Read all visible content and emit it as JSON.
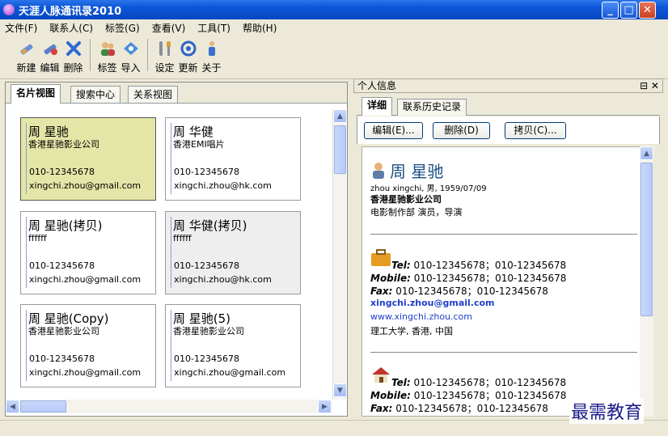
{
  "window": {
    "title": "天涯人脉通讯录2010"
  },
  "menu": [
    "文件(F)",
    "联系人(C)",
    "标签(G)",
    "查看(V)",
    "工具(T)",
    "帮助(H)"
  ],
  "toolbar": {
    "new": "新建",
    "edit": "编辑",
    "delete": "删除",
    "tag": "标签",
    "import": "导入",
    "settings": "设定",
    "refresh": "更新",
    "about": "关于"
  },
  "left_tabs": [
    "名片视图",
    "搜索中心",
    "关系视图"
  ],
  "cards": [
    {
      "name": "周 星驰",
      "company": "香港星驰影业公司",
      "phone": "010-12345678",
      "email": "xingchi.zhou@gmail.com"
    },
    {
      "name": "周 华健",
      "company": "香港EMI唱片",
      "phone": "010-12345678",
      "email": "xingchi.zhou@hk.com"
    },
    {
      "name": "周 星驰(拷贝)",
      "company": "ffffff",
      "phone": "010-12345678",
      "email": "xingchi.zhou@gmail.com"
    },
    {
      "name": "周 华健(拷贝)",
      "company": "ffffff",
      "phone": "010-12345678",
      "email": "xingchi.zhou@hk.com"
    },
    {
      "name": "周 星驰(Copy)",
      "company": "香港星驰影业公司",
      "phone": "010-12345678",
      "email": "xingchi.zhou@gmail.com"
    },
    {
      "name": "周 星驰(5)",
      "company": "香港星驰影业公司",
      "phone": "010-12345678",
      "email": "xingchi.zhou@gmail.com"
    }
  ],
  "right_panel": {
    "title": "个人信息",
    "tabs": [
      "详细",
      "联系历史记录"
    ],
    "buttons": {
      "edit": "编辑(E)...",
      "delete": "删除(D)",
      "copy": "拷贝(C)..."
    },
    "detail": {
      "name": "周 星驰",
      "sub": "zhou xingchi, 男, 1959/07/09",
      "company": "香港星驰影业公司",
      "dept": "电影制作部 演员，导演",
      "work": {
        "tel_label": "Tel:",
        "tel": "010-12345678；010-12345678",
        "mobile_label": "Mobile:",
        "mobile": "010-12345678；010-12345678",
        "fax_label": "Fax:",
        "fax": "010-12345678；010-12345678",
        "email": "xingchi.zhou@gmail.com",
        "web": "www.xingchi.zhou.com",
        "address": "理工大学, 香港, 中国"
      },
      "home": {
        "tel_label": "Tel:",
        "tel": "010-12345678；010-12345678",
        "mobile_label": "Mobile:",
        "mobile": "010-12345678；010-12345678",
        "fax_label": "Fax:",
        "fax": "010-12345678；010-12345678"
      }
    }
  },
  "watermark": "最需教育"
}
